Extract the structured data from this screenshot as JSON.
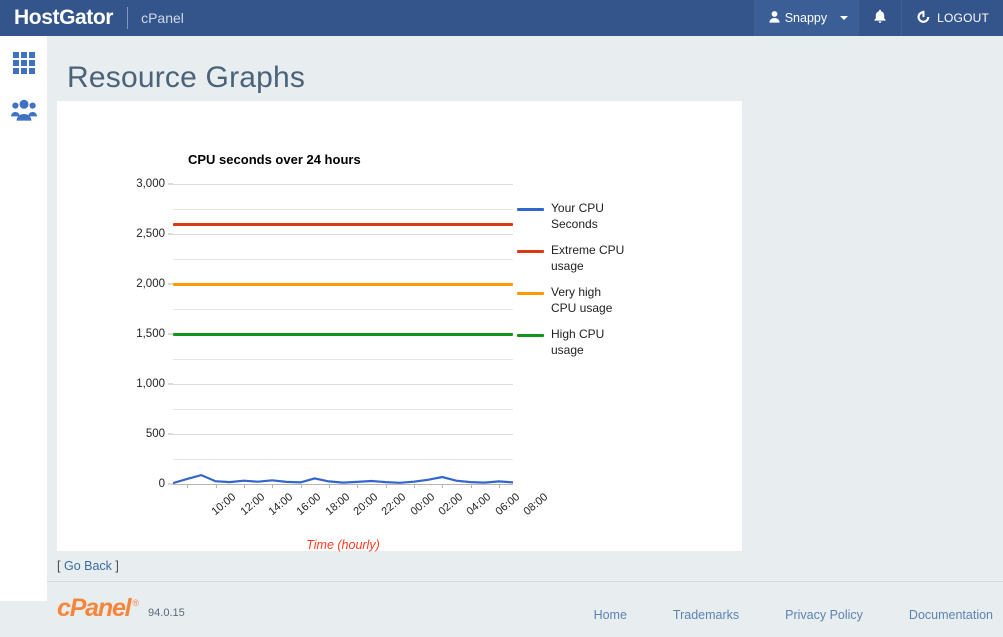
{
  "header": {
    "brand": "HostGator",
    "product": "cPanel",
    "user": "Snappy",
    "user_icon": "user-icon",
    "caret_icon": "chevron-down-icon",
    "bell_icon": "bell-icon",
    "logout_label": "LOGOUT",
    "logout_icon": "logout-icon",
    "bg_color": "#34558b"
  },
  "sidebar": {
    "items": [
      {
        "icon": "grid-apps-icon",
        "name": "sidebar-item-apps"
      },
      {
        "icon": "users-group-icon",
        "name": "sidebar-item-users"
      }
    ],
    "icon_color": "#3f72c0"
  },
  "page": {
    "title": "Resource Graphs"
  },
  "chart_data": {
    "type": "line",
    "title": "CPU seconds over 24 hours",
    "xlabel": "Time (hourly)",
    "ylabel": "",
    "ylim": [
      0,
      3000
    ],
    "grid": true,
    "legend_position": "right",
    "y_ticks": [
      "0",
      "500",
      "1,000",
      "1,500",
      "2,000",
      "2,500",
      "3,000"
    ],
    "y_tick_values": [
      0,
      500,
      1000,
      1500,
      2000,
      2500,
      3000
    ],
    "minor_gridline_values": [
      250,
      750,
      1250,
      1750,
      2250,
      2750
    ],
    "categories": [
      "10:00",
      "12:00",
      "14:00",
      "16:00",
      "18:00",
      "20:00",
      "22:00",
      "00:00",
      "02:00",
      "04:00",
      "06:00",
      "08:00"
    ],
    "series": [
      {
        "name": "Your CPU Seconds",
        "color": "#3366cc",
        "type": "line",
        "values": [
          4,
          22,
          38,
          12,
          8,
          14,
          10,
          16,
          9,
          7,
          24,
          11,
          6,
          9,
          13,
          8,
          5,
          10,
          18,
          30,
          14,
          8,
          6,
          11,
          7
        ]
      },
      {
        "name": "Extreme CPU usage",
        "color": "#dc3912",
        "type": "threshold",
        "value": 2600
      },
      {
        "name": "Very high CPU usage",
        "color": "#ff9900",
        "type": "threshold",
        "value": 2000
      },
      {
        "name": "High CPU usage",
        "color": "#109618",
        "type": "threshold",
        "value": 1500
      }
    ],
    "legend": [
      {
        "label": "Your CPU Seconds",
        "color": "#3366cc"
      },
      {
        "label": "Extreme CPU usage",
        "color": "#dc3912"
      },
      {
        "label": "Very high CPU usage",
        "color": "#ff9900"
      },
      {
        "label": "High CPU usage",
        "color": "#109618"
      }
    ]
  },
  "below_card": {
    "go_back_open": "[",
    "go_back_label": "Go Back",
    "go_back_close": "]"
  },
  "footer": {
    "logo_text": "cPanel",
    "registered_mark": "®",
    "version": "94.0.15",
    "links": [
      {
        "label": "Home"
      },
      {
        "label": "Trademarks"
      },
      {
        "label": "Privacy Policy"
      },
      {
        "label": "Documentation"
      }
    ],
    "link_color": "#5d83b1"
  }
}
